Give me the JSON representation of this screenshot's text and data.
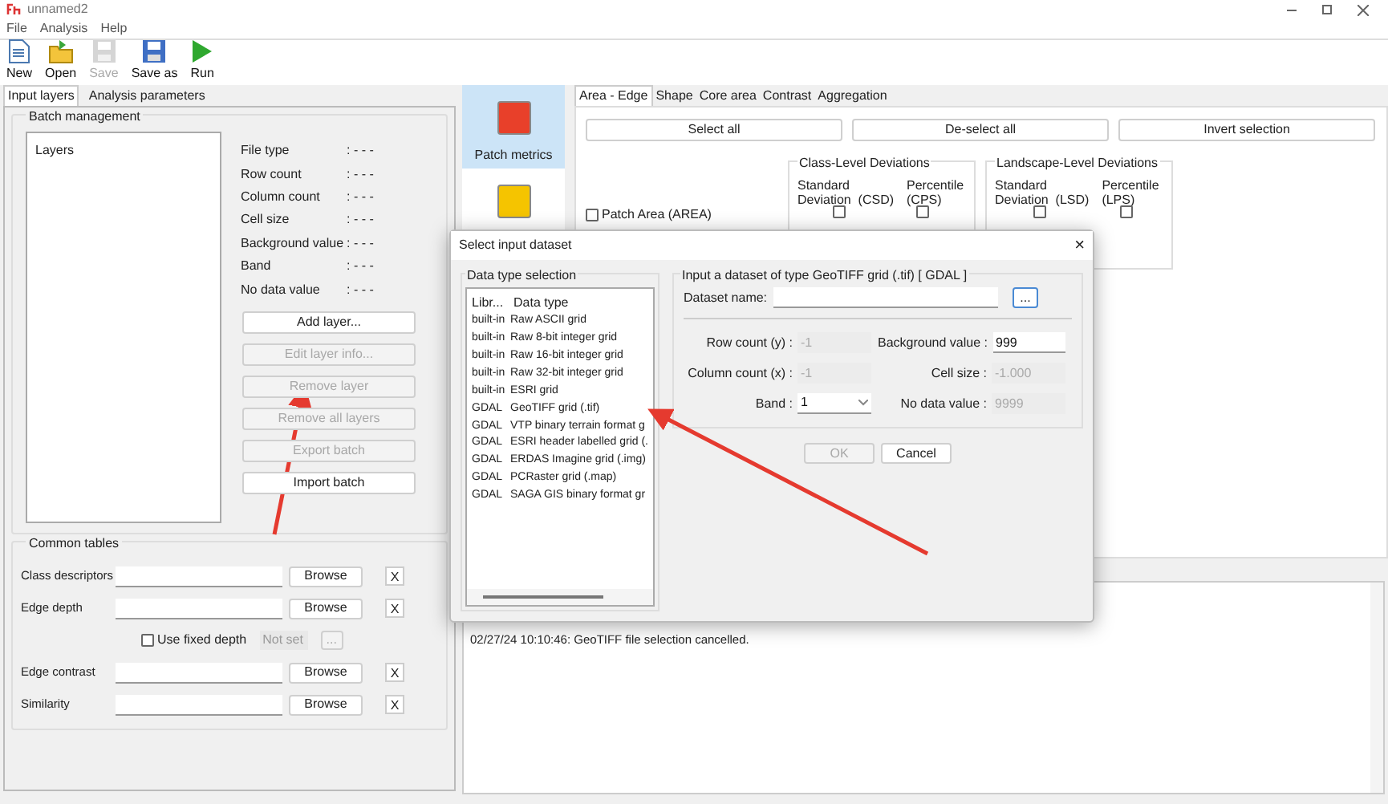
{
  "window": {
    "title": "unnamed2"
  },
  "menu": [
    "File",
    "Analysis",
    "Help"
  ],
  "toolbar": [
    {
      "kind": "new",
      "label": "New",
      "disabled": false
    },
    {
      "kind": "open",
      "label": "Open",
      "disabled": false
    },
    {
      "kind": "save",
      "label": "Save",
      "disabled": true
    },
    {
      "kind": "saveas",
      "label": "Save as",
      "disabled": false
    },
    {
      "kind": "run",
      "label": "Run",
      "disabled": false
    }
  ],
  "left_tabs": [
    {
      "label": "Input layers",
      "selected": true
    },
    {
      "label": "Analysis parameters",
      "selected": false
    }
  ],
  "batch": {
    "title": "Batch management",
    "list_header": "Layers",
    "info": [
      {
        "label": "File type",
        "value": ": - - -"
      },
      {
        "label": "Row count",
        "value": ": - - -"
      },
      {
        "label": "Column count",
        "value": ": - - -"
      },
      {
        "label": "Cell size",
        "value": ": - - -"
      },
      {
        "label": "Background value",
        "value": ": - - -"
      },
      {
        "label": "Band",
        "value": ": - - -"
      },
      {
        "label": "No data value",
        "value": ": - - -"
      }
    ],
    "buttons": [
      {
        "label": "Add layer...",
        "disabled": false
      },
      {
        "label": "Edit layer info...",
        "disabled": true
      },
      {
        "label": "Remove layer",
        "disabled": true
      },
      {
        "label": "Remove all layers",
        "disabled": true
      },
      {
        "label": "Export batch",
        "disabled": true
      },
      {
        "label": "Import batch",
        "disabled": false
      }
    ]
  },
  "common": {
    "title": "Common tables",
    "rows": [
      {
        "kind": "table",
        "label": "Class descriptors",
        "button": "Browse",
        "clear": "X"
      },
      {
        "kind": "table",
        "label": "Edge depth",
        "button": "Browse",
        "clear": "X"
      },
      {
        "kind": "fixed_depth",
        "label": "Use fixed depth",
        "checked": false,
        "placeholder": "Not set",
        "button": "..."
      },
      {
        "kind": "table",
        "label": "Edge contrast",
        "button": "Browse",
        "clear": "X"
      },
      {
        "kind": "table",
        "label": "Similarity",
        "button": "Browse",
        "clear": "X"
      }
    ]
  },
  "metric_levels": [
    {
      "label": "Patch metrics",
      "color": "#e8402a",
      "selected": true
    },
    {
      "color": "#f5c400",
      "selected": false
    }
  ],
  "metric_tabs": [
    {
      "label": "Area - Edge",
      "selected": true
    },
    {
      "label": "Shape",
      "selected": false
    },
    {
      "label": "Core area",
      "selected": false
    },
    {
      "label": "Contrast",
      "selected": false
    },
    {
      "label": "Aggregation",
      "selected": false
    }
  ],
  "selection_buttons": [
    "Select all",
    "De-select all",
    "Invert selection"
  ],
  "deviation_groups": [
    {
      "title": "Class-Level Deviations",
      "columns": [
        "Standard\nDeviation  (CSD)",
        "Percentile\n(CPS)"
      ]
    },
    {
      "title": "Landscape-Level Deviations",
      "columns": [
        "Standard\nDeviation  (LSD)",
        "Percentile\n(LPS)"
      ]
    }
  ],
  "metrics": [
    {
      "label": "Patch Area  (AREA)",
      "checked": false,
      "checks": [
        false,
        false,
        false,
        false
      ]
    }
  ],
  "log": [
    "02/27/24 10:10:46: GeoTIFF file selection cancelled."
  ],
  "dialog": {
    "title": "Select input dataset",
    "close": "×",
    "type_group": "Data type selection",
    "columns": [
      "Libr...",
      "Data type"
    ],
    "types": [
      [
        "built-in",
        "Raw ASCII grid"
      ],
      [
        "built-in",
        "Raw 8-bit integer grid"
      ],
      [
        "built-in",
        "Raw 16-bit integer grid"
      ],
      [
        "built-in",
        "Raw 32-bit integer grid"
      ],
      [
        "built-in",
        "ESRI grid"
      ],
      [
        "GDAL",
        "GeoTIFF grid (.tif)"
      ],
      [
        "GDAL",
        "VTP binary terrain format g"
      ],
      [
        "GDAL",
        "ESRI header labelled grid (."
      ],
      [
        "GDAL",
        "ERDAS Imagine grid (.img)"
      ],
      [
        "GDAL",
        "PCRaster grid (.map)"
      ],
      [
        "GDAL",
        "SAGA GIS binary format gr"
      ]
    ],
    "input_group": "Input a dataset of type GeoTIFF grid (.tif) [ GDAL ]",
    "dataset_label": "Dataset name:",
    "browse": "...",
    "fields": [
      {
        "label": "Row count (y) :",
        "value": "-1",
        "disabled": true
      },
      {
        "label": "Background value :",
        "value": "999",
        "disabled": false
      },
      {
        "label": "Column count (x) :",
        "value": "-1",
        "disabled": true
      },
      {
        "label": "Cell size :",
        "value": "-1.000",
        "disabled": true
      },
      {
        "label": "Band :",
        "value": "1",
        "disabled": false,
        "kind": "select"
      },
      {
        "label": "No data value :",
        "value": "9999",
        "disabled": true
      }
    ],
    "ok": {
      "label": "OK",
      "disabled": true
    },
    "cancel": {
      "label": "Cancel",
      "disabled": false
    }
  }
}
